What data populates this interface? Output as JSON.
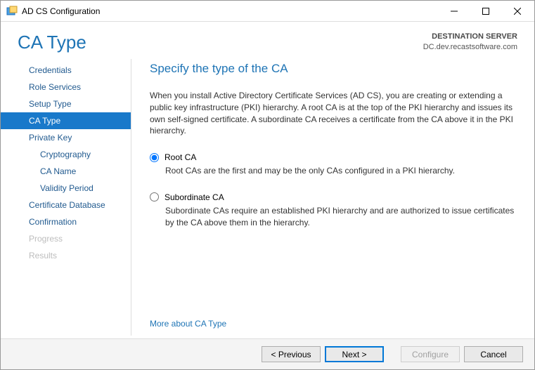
{
  "window": {
    "title": "AD CS Configuration"
  },
  "header": {
    "page_title": "CA Type",
    "destination_label": "DESTINATION SERVER",
    "destination_host": "DC.dev.recastsoftware.com"
  },
  "sidebar": {
    "items": [
      {
        "label": "Credentials",
        "selected": false,
        "sub": false,
        "disabled": false
      },
      {
        "label": "Role Services",
        "selected": false,
        "sub": false,
        "disabled": false
      },
      {
        "label": "Setup Type",
        "selected": false,
        "sub": false,
        "disabled": false
      },
      {
        "label": "CA Type",
        "selected": true,
        "sub": false,
        "disabled": false
      },
      {
        "label": "Private Key",
        "selected": false,
        "sub": false,
        "disabled": false
      },
      {
        "label": "Cryptography",
        "selected": false,
        "sub": true,
        "disabled": false
      },
      {
        "label": "CA Name",
        "selected": false,
        "sub": true,
        "disabled": false
      },
      {
        "label": "Validity Period",
        "selected": false,
        "sub": true,
        "disabled": false
      },
      {
        "label": "Certificate Database",
        "selected": false,
        "sub": false,
        "disabled": false
      },
      {
        "label": "Confirmation",
        "selected": false,
        "sub": false,
        "disabled": false
      },
      {
        "label": "Progress",
        "selected": false,
        "sub": false,
        "disabled": true
      },
      {
        "label": "Results",
        "selected": false,
        "sub": false,
        "disabled": true
      }
    ]
  },
  "content": {
    "heading": "Specify the type of the CA",
    "intro": "When you install Active Directory Certificate Services (AD CS), you are creating or extending a public key infrastructure (PKI) hierarchy. A root CA is at the top of the PKI hierarchy and issues its own self-signed certificate. A subordinate CA receives a certificate from the CA above it in the PKI hierarchy.",
    "options": [
      {
        "label": "Root CA",
        "desc": "Root CAs are the first and may be the only CAs configured in a PKI hierarchy.",
        "checked": true
      },
      {
        "label": "Subordinate CA",
        "desc": "Subordinate CAs require an established PKI hierarchy and are authorized to issue certificates by the CA above them in the hierarchy.",
        "checked": false
      }
    ],
    "more_link": "More about CA Type"
  },
  "footer": {
    "previous": "< Previous",
    "next": "Next >",
    "configure": "Configure",
    "cancel": "Cancel"
  }
}
